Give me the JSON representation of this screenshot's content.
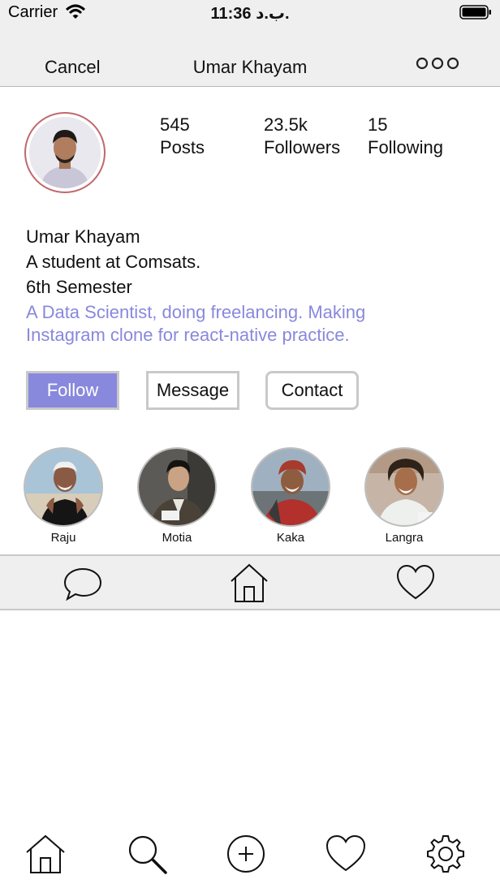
{
  "status_bar": {
    "carrier": "Carrier",
    "time": "11:36 ب.د."
  },
  "nav": {
    "cancel_label": "Cancel",
    "title": "Umar Khayam",
    "more_icon": "ellipsis-icon"
  },
  "profile": {
    "stats": [
      {
        "value": "545",
        "label": "Posts"
      },
      {
        "value": "23.5k",
        "label": "Followers"
      },
      {
        "value": "15",
        "label": "Following"
      }
    ],
    "bio": {
      "name": "Umar Khayam",
      "line1": "A student at Comsats.",
      "line2": "6th Semester",
      "link_line1": "A Data Scientist, doing freelancing. Making",
      "link_line2": "Instagram clone for react-native practice."
    }
  },
  "actions": {
    "follow_label": "Follow",
    "message_label": "Message",
    "contact_label": "Contact"
  },
  "stories": [
    {
      "name": "Raju"
    },
    {
      "name": "Motia"
    },
    {
      "name": "Kaka"
    },
    {
      "name": "Langra"
    }
  ],
  "mid_tabs": [
    "chat-bubble-icon",
    "home-icon",
    "heart-icon"
  ],
  "bottom_tabs": [
    "home-icon",
    "search-icon",
    "add-icon",
    "heart-icon",
    "settings-icon"
  ],
  "colors": {
    "accent": "#8888dd",
    "avatar_ring": "#c0686e",
    "bar_background": "#efefef"
  }
}
